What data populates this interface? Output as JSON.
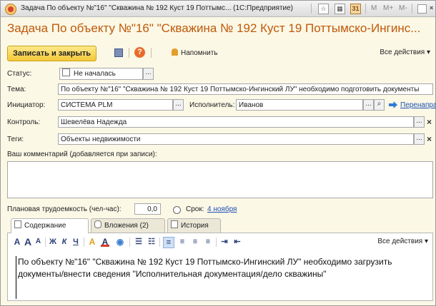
{
  "window": {
    "title": "Задача По объекту №\"16\" \"Скважина № 192 Куст 19 Поттымс... (1С:Предприятие)",
    "controls": [
      "M",
      "M+",
      "M-"
    ]
  },
  "form": {
    "title": "Задача По объекту №\"16\" \"Скважина № 192 Куст 19 Поттымско-Ингинс..."
  },
  "toolbar": {
    "save_close": "Записать и закрыть",
    "remind": "Напомнить",
    "all_actions": "Все действия ▾"
  },
  "fields": {
    "status_label": "Статус:",
    "status_value": "Не началась",
    "subject_label": "Тема:",
    "subject_value": "По объекту №\"16\" \"Скважина № 192 Куст 19 Поттымско-Ингинский ЛУ\" необходимо подготовить документы",
    "initiator_label": "Инициатор:",
    "initiator_value": "СИСТЕМА PLM",
    "executor_label": "Исполнитель:",
    "executor_value": "Иванов",
    "redirect_label": "Перенаправить",
    "control_label": "Контроль:",
    "control_value": "Шевелёва Надежда",
    "tags_label": "Теги:",
    "tags_value": "Объекты недвижимости",
    "comment_label": "Ваш комментарий (добавляется при записи):",
    "plan_label": "Плановая трудоемкость (чел-час):",
    "plan_value": "0,0",
    "due_label": "Срок:",
    "due_value": "4 ноября"
  },
  "tabs": [
    {
      "label": "Содержание",
      "active": true
    },
    {
      "label": "Вложения (2)",
      "active": false
    },
    {
      "label": "История",
      "active": false
    }
  ],
  "editor": {
    "all_actions": "Все действия ▾",
    "content": "По объекту №\"16\" \"Скважина № 192 Куст 19 Поттымско-Ингинский ЛУ\" необходимо загрузить документы/внести сведения \"Исполнительная документация/дело скважины\"",
    "tool_labels": {
      "bold": "Ж",
      "italic": "К",
      "underline": "Ч"
    }
  },
  "colors": {
    "form_title": "#c0590a",
    "save_button": "#f4c839",
    "background": "#fbf8e6",
    "link": "#1d4fb7"
  }
}
